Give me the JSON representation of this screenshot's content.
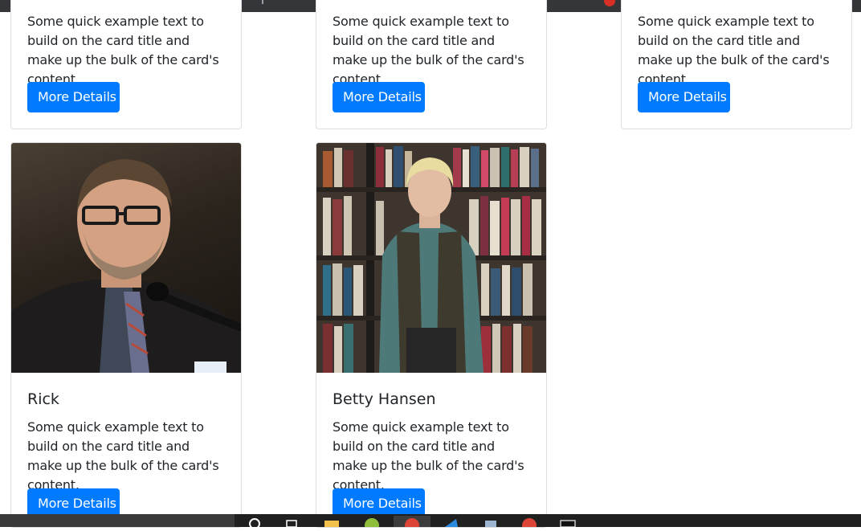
{
  "cards": [
    {
      "text": "Some quick example text to build on the card title and make up the bulk of the card's content.",
      "button": "More Details"
    },
    {
      "text": "Some quick example text to build on the card title and make up the bulk of the card's content.",
      "button": "More Details"
    },
    {
      "text": "Some quick example text to build on the card title and make up the bulk of the card's content.",
      "button": "More Details"
    },
    {
      "title": "Rick",
      "text": "Some quick example text to build on the card title and make up the bulk of the card's content.",
      "button": "More Details",
      "image": "portrait-photo"
    },
    {
      "title": "Betty Hansen",
      "text": "Some quick example text to build on the card title and make up the bulk of the card's content.",
      "button": "More Details",
      "image": "portrait-photo"
    }
  ],
  "colors": {
    "primary": "#007bff",
    "taskbar": "#202020",
    "tabstrip": "#35363a"
  },
  "taskbar_icons": [
    "search-icon",
    "task-view-icon",
    "file-explorer-icon",
    "app-icon",
    "chrome-icon",
    "vscode-icon",
    "app-icon",
    "chrome-icon",
    "terminal-icon"
  ]
}
